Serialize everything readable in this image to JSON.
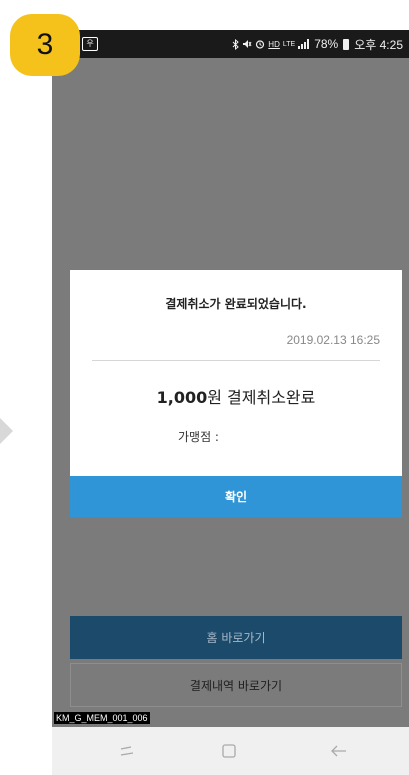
{
  "step": {
    "number": "3"
  },
  "status_bar": {
    "sim_icon": "sim-icon",
    "status_icons": "bluetooth-icon mute-icon alarm-icon hd-icon lte-icon signal-icon",
    "battery_percent": "78%",
    "time": "오후 4:25"
  },
  "dialog": {
    "message": "결제취소가 완료되었습니다.",
    "timestamp": "2019.02.13 16:25",
    "amount_value": "1,000",
    "amount_suffix": "원 결제취소완료",
    "merchant_label": "가맹점 :",
    "confirm_label": "확인"
  },
  "buttons": {
    "home_label": "홈 바로가기",
    "history_label": "결제내역 바로가기"
  },
  "screen_code": "KM_G_MEM_001_006",
  "colors": {
    "badge": "#f4c21a",
    "overlay": "#7b7b7b",
    "confirm": "#2f95d6",
    "home_button": "#1b4a6a"
  }
}
